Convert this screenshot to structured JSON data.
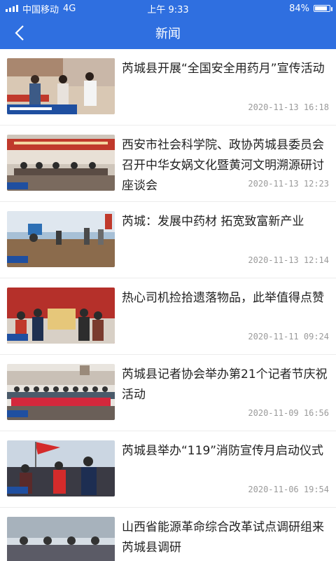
{
  "status_bar": {
    "carrier": "中国移动",
    "network": "4G",
    "time": "上午 9:33",
    "battery_percent": "84%",
    "battery_level": 0.84
  },
  "navbar": {
    "title": "新闻",
    "back_icon": "chevron-left-icon"
  },
  "colors": {
    "header": "#2f6fe0",
    "time_text": "#9a9a9a"
  },
  "news": [
    {
      "title": "芮城县开展“全国安全用药月”宣传活动",
      "time": "2020-11-13 16:18"
    },
    {
      "title": "西安市社会科学院、政协芮城县委员会召开中华女娲文化暨黄河文明溯源研讨座谈会",
      "time": "2020-11-13 12:23"
    },
    {
      "title": "芮城：发展中药材 拓宽致富新产业",
      "time": "2020-11-13 12:14"
    },
    {
      "title": "热心司机捡拾遗落物品，此举值得点赞",
      "time": "2020-11-11 09:24"
    },
    {
      "title": "芮城县记者协会举办第21个记者节庆祝活动",
      "time": "2020-11-09 16:56"
    },
    {
      "title": "芮城县举办“119”消防宣传月启动仪式",
      "time": "2020-11-06 19:54"
    },
    {
      "title": "山西省能源革命综合改革试点调研组来芮城县调研",
      "time": ""
    }
  ]
}
